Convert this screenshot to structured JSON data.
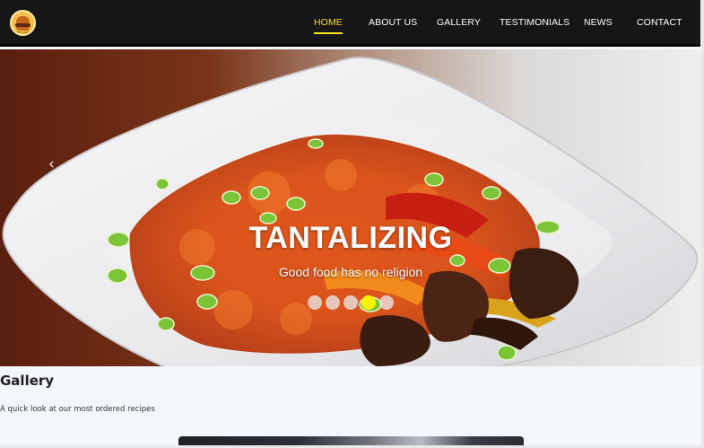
{
  "brand": {
    "logo_text": "EAT SIDE"
  },
  "nav": {
    "items": [
      {
        "label": "HOME",
        "active": true
      },
      {
        "label": "ABOUT US",
        "active": false
      },
      {
        "label": "GALLERY",
        "active": false
      },
      {
        "label": "TESTIMONIALS",
        "active": false
      },
      {
        "label": "NEWS",
        "active": false
      },
      {
        "label": "CONTACT",
        "active": false
      }
    ]
  },
  "hero": {
    "title": "TANTALIZING",
    "subtitle": "Good food has no religion",
    "prev_icon": "chevron-left-icon",
    "next_icon": "chevron-right-icon",
    "slide_count": 5,
    "active_slide": 4
  },
  "gallery": {
    "title": "Gallery",
    "subtitle": "A quick look at our most ordered recipes"
  },
  "colors": {
    "nav_background": "#161616",
    "accent": "#f5e21b",
    "active_dot": "#fff200"
  }
}
